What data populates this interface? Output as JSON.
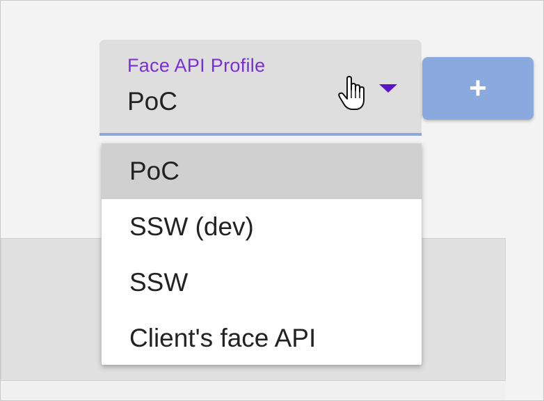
{
  "profile_select": {
    "label": "Face API Profile",
    "value": "PoC",
    "arrow_icon": "triangle-down-icon",
    "label_color": "#7a2fd6",
    "underline_color": "#8aa8dc"
  },
  "add_button": {
    "label": "+",
    "color": "#8aa9de"
  },
  "menu": {
    "items": [
      {
        "label": "PoC",
        "selected": true
      },
      {
        "label": "SSW (dev)",
        "selected": false
      },
      {
        "label": "SSW",
        "selected": false
      },
      {
        "label": "Client's face API",
        "selected": false
      }
    ]
  }
}
